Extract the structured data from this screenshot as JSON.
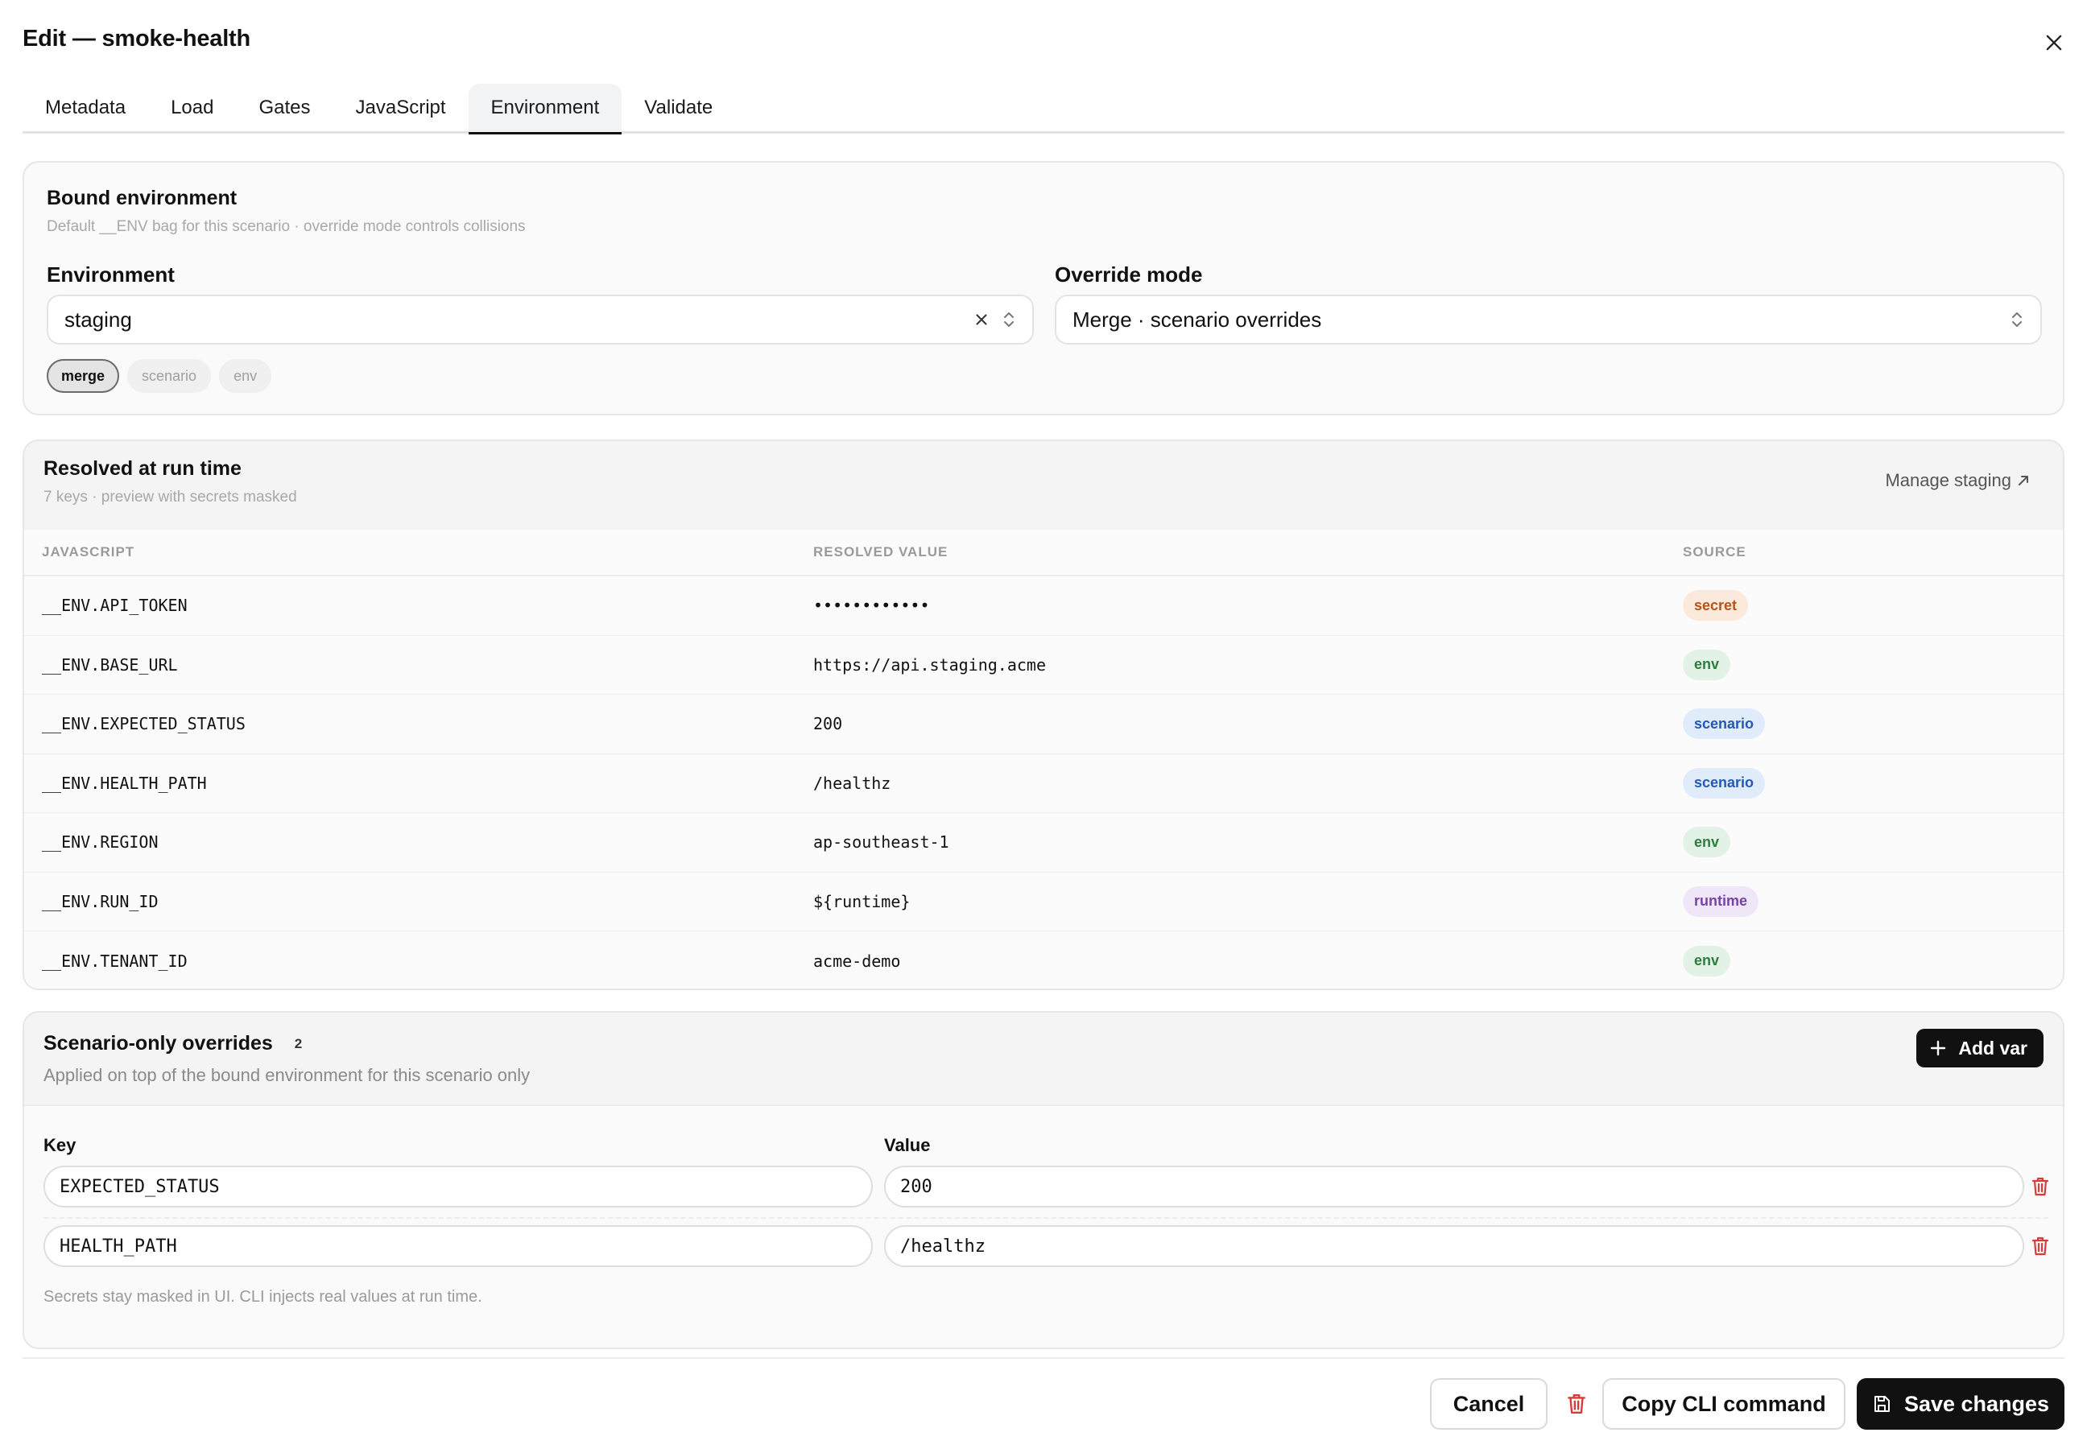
{
  "dialog": {
    "title": "Edit — smoke-health"
  },
  "tabs": [
    {
      "label": "Metadata"
    },
    {
      "label": "Load"
    },
    {
      "label": "Gates"
    },
    {
      "label": "JavaScript"
    },
    {
      "label": "Environment",
      "active": true
    },
    {
      "label": "Validate"
    }
  ],
  "bound": {
    "title": "Bound environment",
    "subtitle": "Default __ENV bag for this scenario · override mode controls collisions",
    "environment_label": "Environment",
    "environment_value": "staging",
    "override_label": "Override mode",
    "override_value": "Merge · scenario overrides",
    "chips": [
      {
        "label": "merge",
        "active": true
      },
      {
        "label": "scenario"
      },
      {
        "label": "env"
      }
    ]
  },
  "resolved": {
    "title": "Resolved at run time",
    "subtitle": "7 keys · preview with secrets masked",
    "manage_link": "Manage staging",
    "columns": {
      "js": "JAVASCRIPT",
      "value": "RESOLVED VALUE",
      "source": "SOURCE"
    },
    "rows": [
      {
        "key": "__ENV.API_TOKEN",
        "value": "••••••••••••",
        "source": "secret"
      },
      {
        "key": "__ENV.BASE_URL",
        "value": "https://api.staging.acme",
        "source": "env"
      },
      {
        "key": "__ENV.EXPECTED_STATUS",
        "value": "200",
        "source": "scenario"
      },
      {
        "key": "__ENV.HEALTH_PATH",
        "value": "/healthz",
        "source": "scenario"
      },
      {
        "key": "__ENV.REGION",
        "value": "ap-southeast-1",
        "source": "env"
      },
      {
        "key": "__ENV.RUN_ID",
        "value": "${runtime}",
        "source": "runtime"
      },
      {
        "key": "__ENV.TENANT_ID",
        "value": "acme-demo",
        "source": "env"
      }
    ],
    "badge_colors": {
      "secret": {
        "bg": "#fbe9dc",
        "fg": "#b4531a"
      },
      "env": {
        "bg": "#e3f2e6",
        "fg": "#2e7d3e"
      },
      "scenario": {
        "bg": "#e1ecfb",
        "fg": "#2557b8"
      },
      "runtime": {
        "bg": "#efe6f7",
        "fg": "#7443a8"
      }
    }
  },
  "overrides": {
    "title": "Scenario-only overrides",
    "count": "2",
    "subtitle": "Applied on top of the bound environment for this scenario only",
    "add_label": "Add var",
    "key_label": "Key",
    "value_label": "Value",
    "rows": [
      {
        "key": "EXPECTED_STATUS",
        "value": "200"
      },
      {
        "key": "HEALTH_PATH",
        "value": "/healthz"
      }
    ],
    "footnote": "Secrets stay masked in UI. CLI injects real values at run time."
  },
  "footer": {
    "cancel": "Cancel",
    "copy_cli": "Copy CLI command",
    "save": "Save changes"
  },
  "colors": {
    "danger": "#d93a3a",
    "ink": "#111111"
  }
}
